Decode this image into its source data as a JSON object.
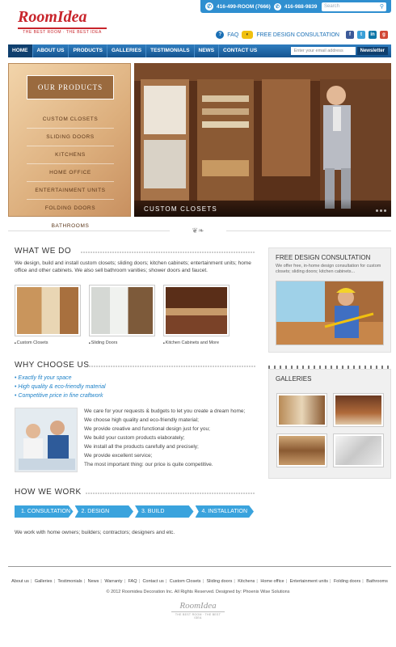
{
  "topbar": {
    "phone1": "416-499-ROOM (7666)",
    "phone2": "416-988-9839",
    "search_placeholder": "Search"
  },
  "logo": {
    "name": "RoomIdea",
    "tagline": "THE BEST ROOM · THE BEST IDEA"
  },
  "toplinks": {
    "faq": "FAQ",
    "consultation": "FREE DESIGN CONSULTATION"
  },
  "nav": {
    "items": [
      "HOME",
      "ABOUT US",
      "PRODUCTS",
      "GALLERIES",
      "TESTIMONIALS",
      "NEWS",
      "CONTACT US"
    ],
    "email_placeholder": "Enter your email address",
    "newsletter": "Newsletter"
  },
  "products": {
    "title": "OUR PRODUCTS",
    "items": [
      "CUSTOM CLOSETS",
      "SLIDING DOORS",
      "KITCHENS",
      "HOME OFFICE",
      "ENTERTAINMENT UNITS",
      "FOLDING DOORS",
      "BATHROOMS"
    ]
  },
  "hero": {
    "caption": "CUSTOM CLOSETS"
  },
  "what_we_do": {
    "title": "WHAT WE DO",
    "text": "We design, build and install custom closets; sliding doors; kitchen cabinets; entertainment units; home office and other cabinets. We also sell bathroom vanities; shower doors and faucet.",
    "thumbs": [
      "Custom Closets",
      "Sliding Doors",
      "Kitchen Cabinets and More"
    ]
  },
  "why": {
    "title": "WHY CHOOSE US",
    "bullets": [
      "Exactly fit your space",
      "High quality & eco-friendly material",
      "Competitive price in fine craftwork"
    ],
    "lines": [
      "We care for your requests & budgets to let you create a dream home;",
      "We choose high quality and eco-friendly material;",
      "We provide creative and functional design just for you;",
      "We build your custom products elaborately;",
      "We install all the products carefully and precisely;",
      "We provide excellent service;",
      "The most important thing: our price is quite competitive."
    ]
  },
  "how": {
    "title": "HOW WE WORK",
    "steps": [
      "1. CONSULTATION",
      "2. DESIGN",
      "3. BUILD",
      "4. INSTALLATION"
    ],
    "text": "We work with home owners; builders; contractors; designers and etc."
  },
  "sidebar": {
    "consult_title": "FREE DESIGN CONSULTATION",
    "consult_text": "We offer free, in-home design consultation for custom closets; sliding doors; kitchen cabinets...",
    "galleries_title": "GALLERIES"
  },
  "footer": {
    "links": [
      "About us",
      "Galleries",
      "Testimonials",
      "News",
      "Warranty",
      "FAQ",
      "Contact us",
      "Custom Closets",
      "Sliding doors",
      "Kitchens",
      "Home office",
      "Entertainment units",
      "Folding doors",
      "Bathrooms"
    ],
    "copyright": "© 2012 Roomidea Decoration Inc. All Rights Reserved.    Designed by: Phoenix Wise Solutions",
    "logo_name": "RoomIdea",
    "logo_tag": "THE BEST ROOM · THE BEST IDEA"
  },
  "colors": {
    "brand_red": "#c8242b",
    "nav_blue": "#1a5e9c",
    "accent_blue": "#3aa3dd"
  }
}
